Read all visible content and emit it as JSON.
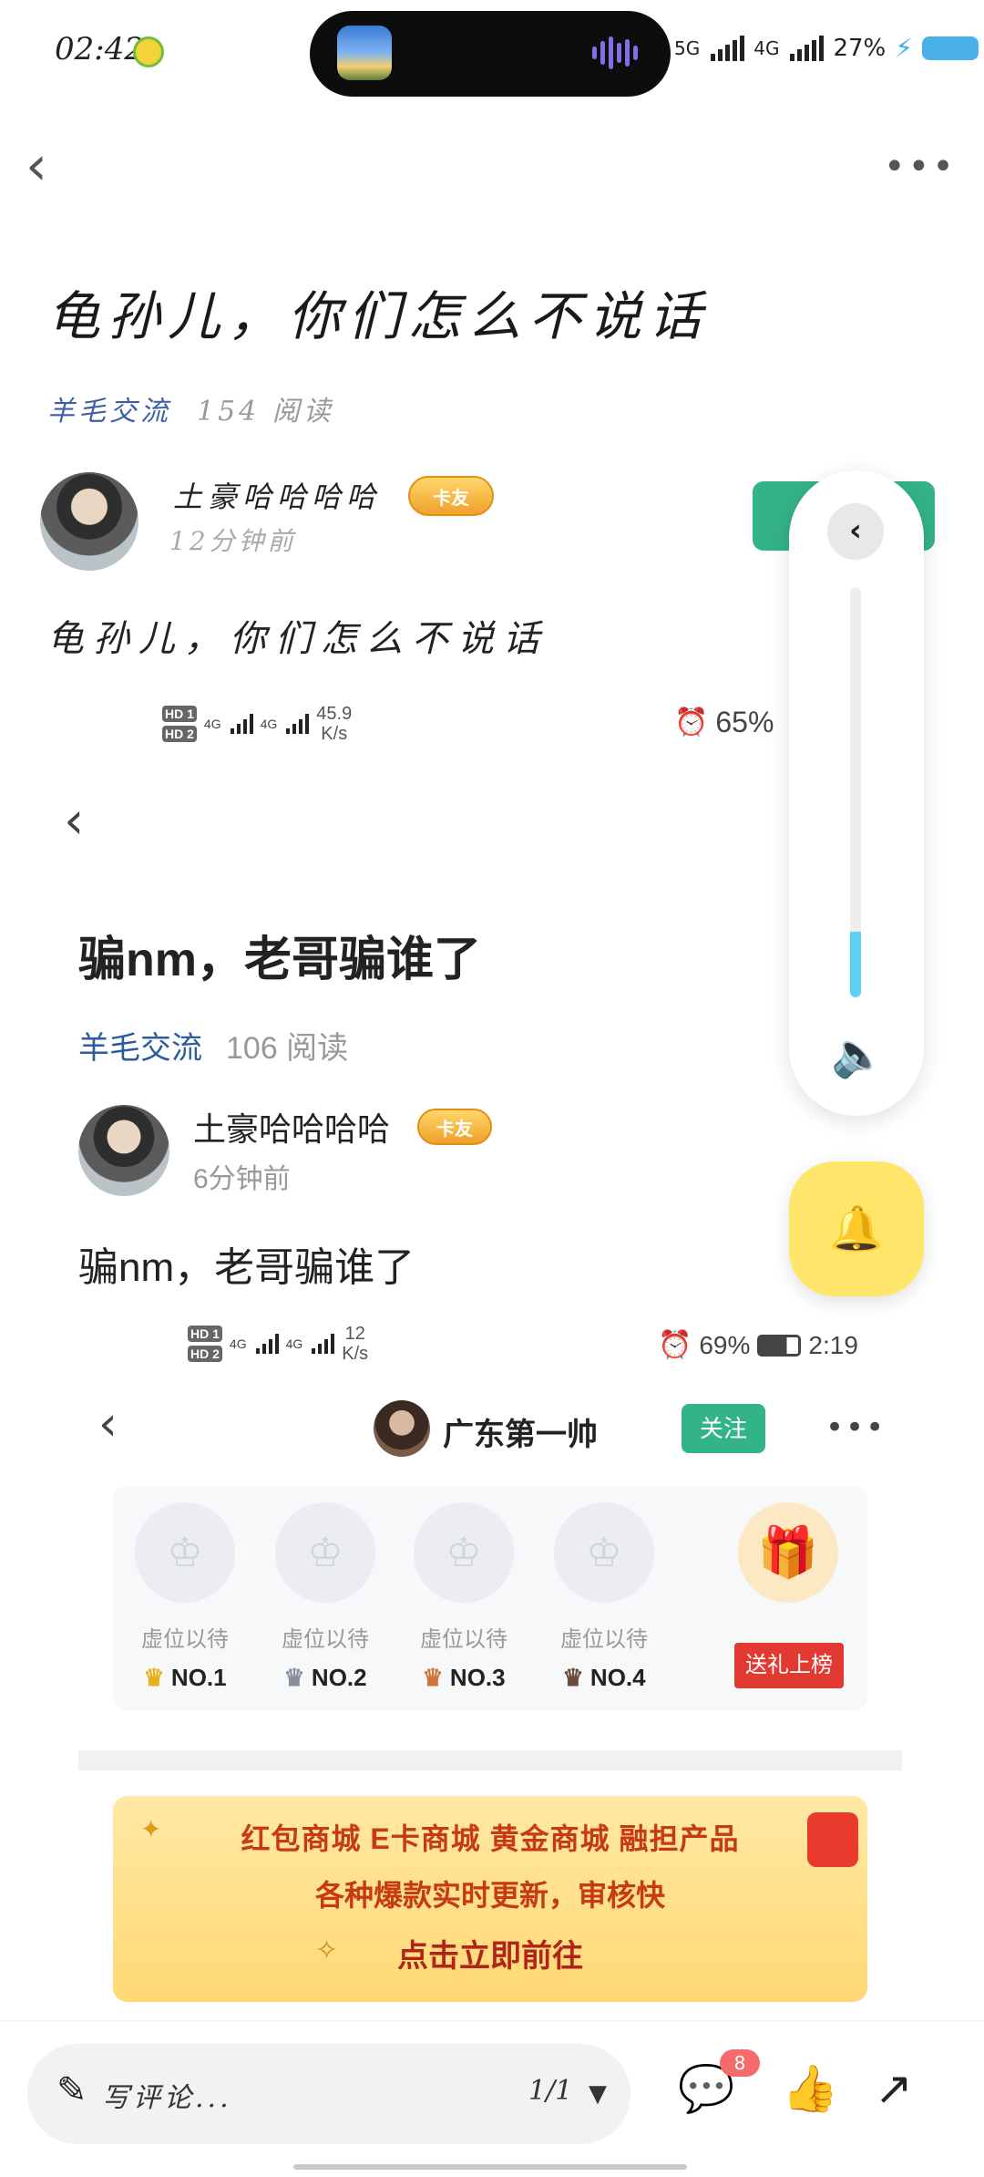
{
  "status_bar": {
    "time": "02:42",
    "signal_a": "5G",
    "signal_b": "4G",
    "battery": "27%"
  },
  "post": {
    "title": "龟孙儿，你们怎么不说话",
    "tag": "羊毛交流",
    "reads": "154 阅读",
    "author": "土豪哈哈哈哈",
    "badge": "卡友",
    "time": "12分钟前",
    "body": "龟孙儿，你们怎么不说话"
  },
  "embedded_1": {
    "status": {
      "hd1": "HD 1",
      "hd2": "HD 2",
      "net_a": "4G",
      "net_b": "4G",
      "speed": "45.9",
      "speed_unit": "K/s",
      "battery": "65%"
    },
    "title": "骗nm，老哥骗谁了",
    "tag": "羊毛交流",
    "reads": "106 阅读",
    "author": "土豪哈哈哈哈",
    "badge": "卡友",
    "time": "6分钟前",
    "body": "骗nm，老哥骗谁了"
  },
  "embedded_2": {
    "status": {
      "hd1": "HD 1",
      "hd2": "HD 2",
      "net_a": "4G",
      "net_b": "4G",
      "speed": "12",
      "speed_unit": "K/s",
      "battery": "69%",
      "time": "2:19"
    },
    "user": "广东第一帅",
    "follow": "关注",
    "slots": [
      {
        "label": "虚位以待",
        "rank": "NO.1"
      },
      {
        "label": "虚位以待",
        "rank": "NO.2"
      },
      {
        "label": "虚位以待",
        "rank": "NO.3"
      },
      {
        "label": "虚位以待",
        "rank": "NO.4"
      }
    ],
    "gift_button": "送礼上榜",
    "banner": {
      "line1": "红包商城  E卡商城  黄金商城  融担产品",
      "line2": "各种爆款实时更新，审核快",
      "line3": "点击立即前往"
    }
  },
  "volume": {
    "level": 0.16,
    "accent": "#5fd0f5"
  },
  "comment_bar": {
    "placeholder": "写评论...",
    "page": "1/1",
    "comment_count": "8"
  },
  "colors": {
    "brand_green": "#34b28a",
    "tag_blue": "#3a5fa8",
    "bell_yellow": "#ffe66b"
  }
}
